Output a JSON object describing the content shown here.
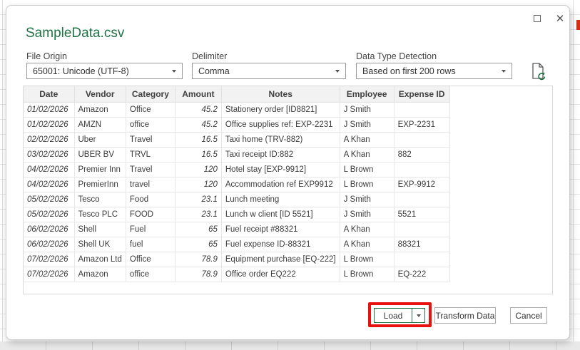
{
  "window": {
    "maximize_label": "maximize",
    "close_glyph": "✕"
  },
  "dialog": {
    "title": "SampleData.csv",
    "fields": {
      "file_origin": {
        "label": "File Origin",
        "value": "65001: Unicode (UTF-8)"
      },
      "delimiter": {
        "label": "Delimiter",
        "value": "Comma"
      },
      "data_type_detection": {
        "label": "Data Type Detection",
        "value": "Based on first 200 rows"
      }
    },
    "icons": {
      "refresh_preview": "file-refresh-icon",
      "combo_caret": "chevron-down-icon"
    },
    "preview_table": {
      "columns": [
        "Date",
        "Vendor",
        "Category",
        "Amount",
        "Notes",
        "Employee",
        "Expense ID"
      ],
      "rows": [
        [
          "01/02/2026",
          "Amazon",
          "Office",
          "45.2",
          "Stationery order [ID8821]",
          "J Smith",
          ""
        ],
        [
          "01/02/2026",
          "AMZN",
          "office",
          "45.2",
          "Office supplies ref: EXP-2231",
          "J Smith",
          "EXP-2231"
        ],
        [
          "02/02/2026",
          "Uber",
          "Travel",
          "16.5",
          "Taxi home (TRV-882)",
          "A Khan",
          ""
        ],
        [
          "03/02/2026",
          "UBER BV",
          "TRVL",
          "16.5",
          "Taxi receipt ID:882",
          "A Khan",
          "882"
        ],
        [
          "04/02/2026",
          "Premier Inn",
          "Travel",
          "120",
          "Hotel stay [EXP-9912]",
          "L Brown",
          ""
        ],
        [
          "04/02/2026",
          "PremierInn",
          "travel",
          "120",
          "Accommodation ref EXP9912",
          "L Brown",
          "EXP-9912"
        ],
        [
          "05/02/2026",
          "Tesco",
          "Food",
          "23.1",
          "Lunch meeting",
          "J Smith",
          ""
        ],
        [
          "05/02/2026",
          "Tesco PLC",
          "FOOD",
          "23.1",
          "Lunch w client [ID 5521]",
          "J Smith",
          "5521"
        ],
        [
          "06/02/2026",
          "Shell",
          "Fuel",
          "65",
          "Fuel receipt #88321",
          "A Khan",
          ""
        ],
        [
          "06/02/2026",
          "Shell UK",
          "fuel",
          "65",
          "Fuel expense ID-88321",
          "A Khan",
          "88321"
        ],
        [
          "07/02/2026",
          "Amazon Ltd",
          "Office",
          "78.9",
          "Equipment purchase [EQ-222]",
          "L Brown",
          ""
        ],
        [
          "07/02/2026",
          "Amazon",
          "office",
          "78.9",
          "Office order EQ222",
          "L Brown",
          "EQ-222"
        ]
      ]
    },
    "buttons": {
      "load": "Load",
      "transform_data": "Transform Data",
      "cancel": "Cancel"
    },
    "colors": {
      "title_green": "#217346",
      "load_border_green": "#217346",
      "annotation_red": "#e8130f"
    }
  }
}
